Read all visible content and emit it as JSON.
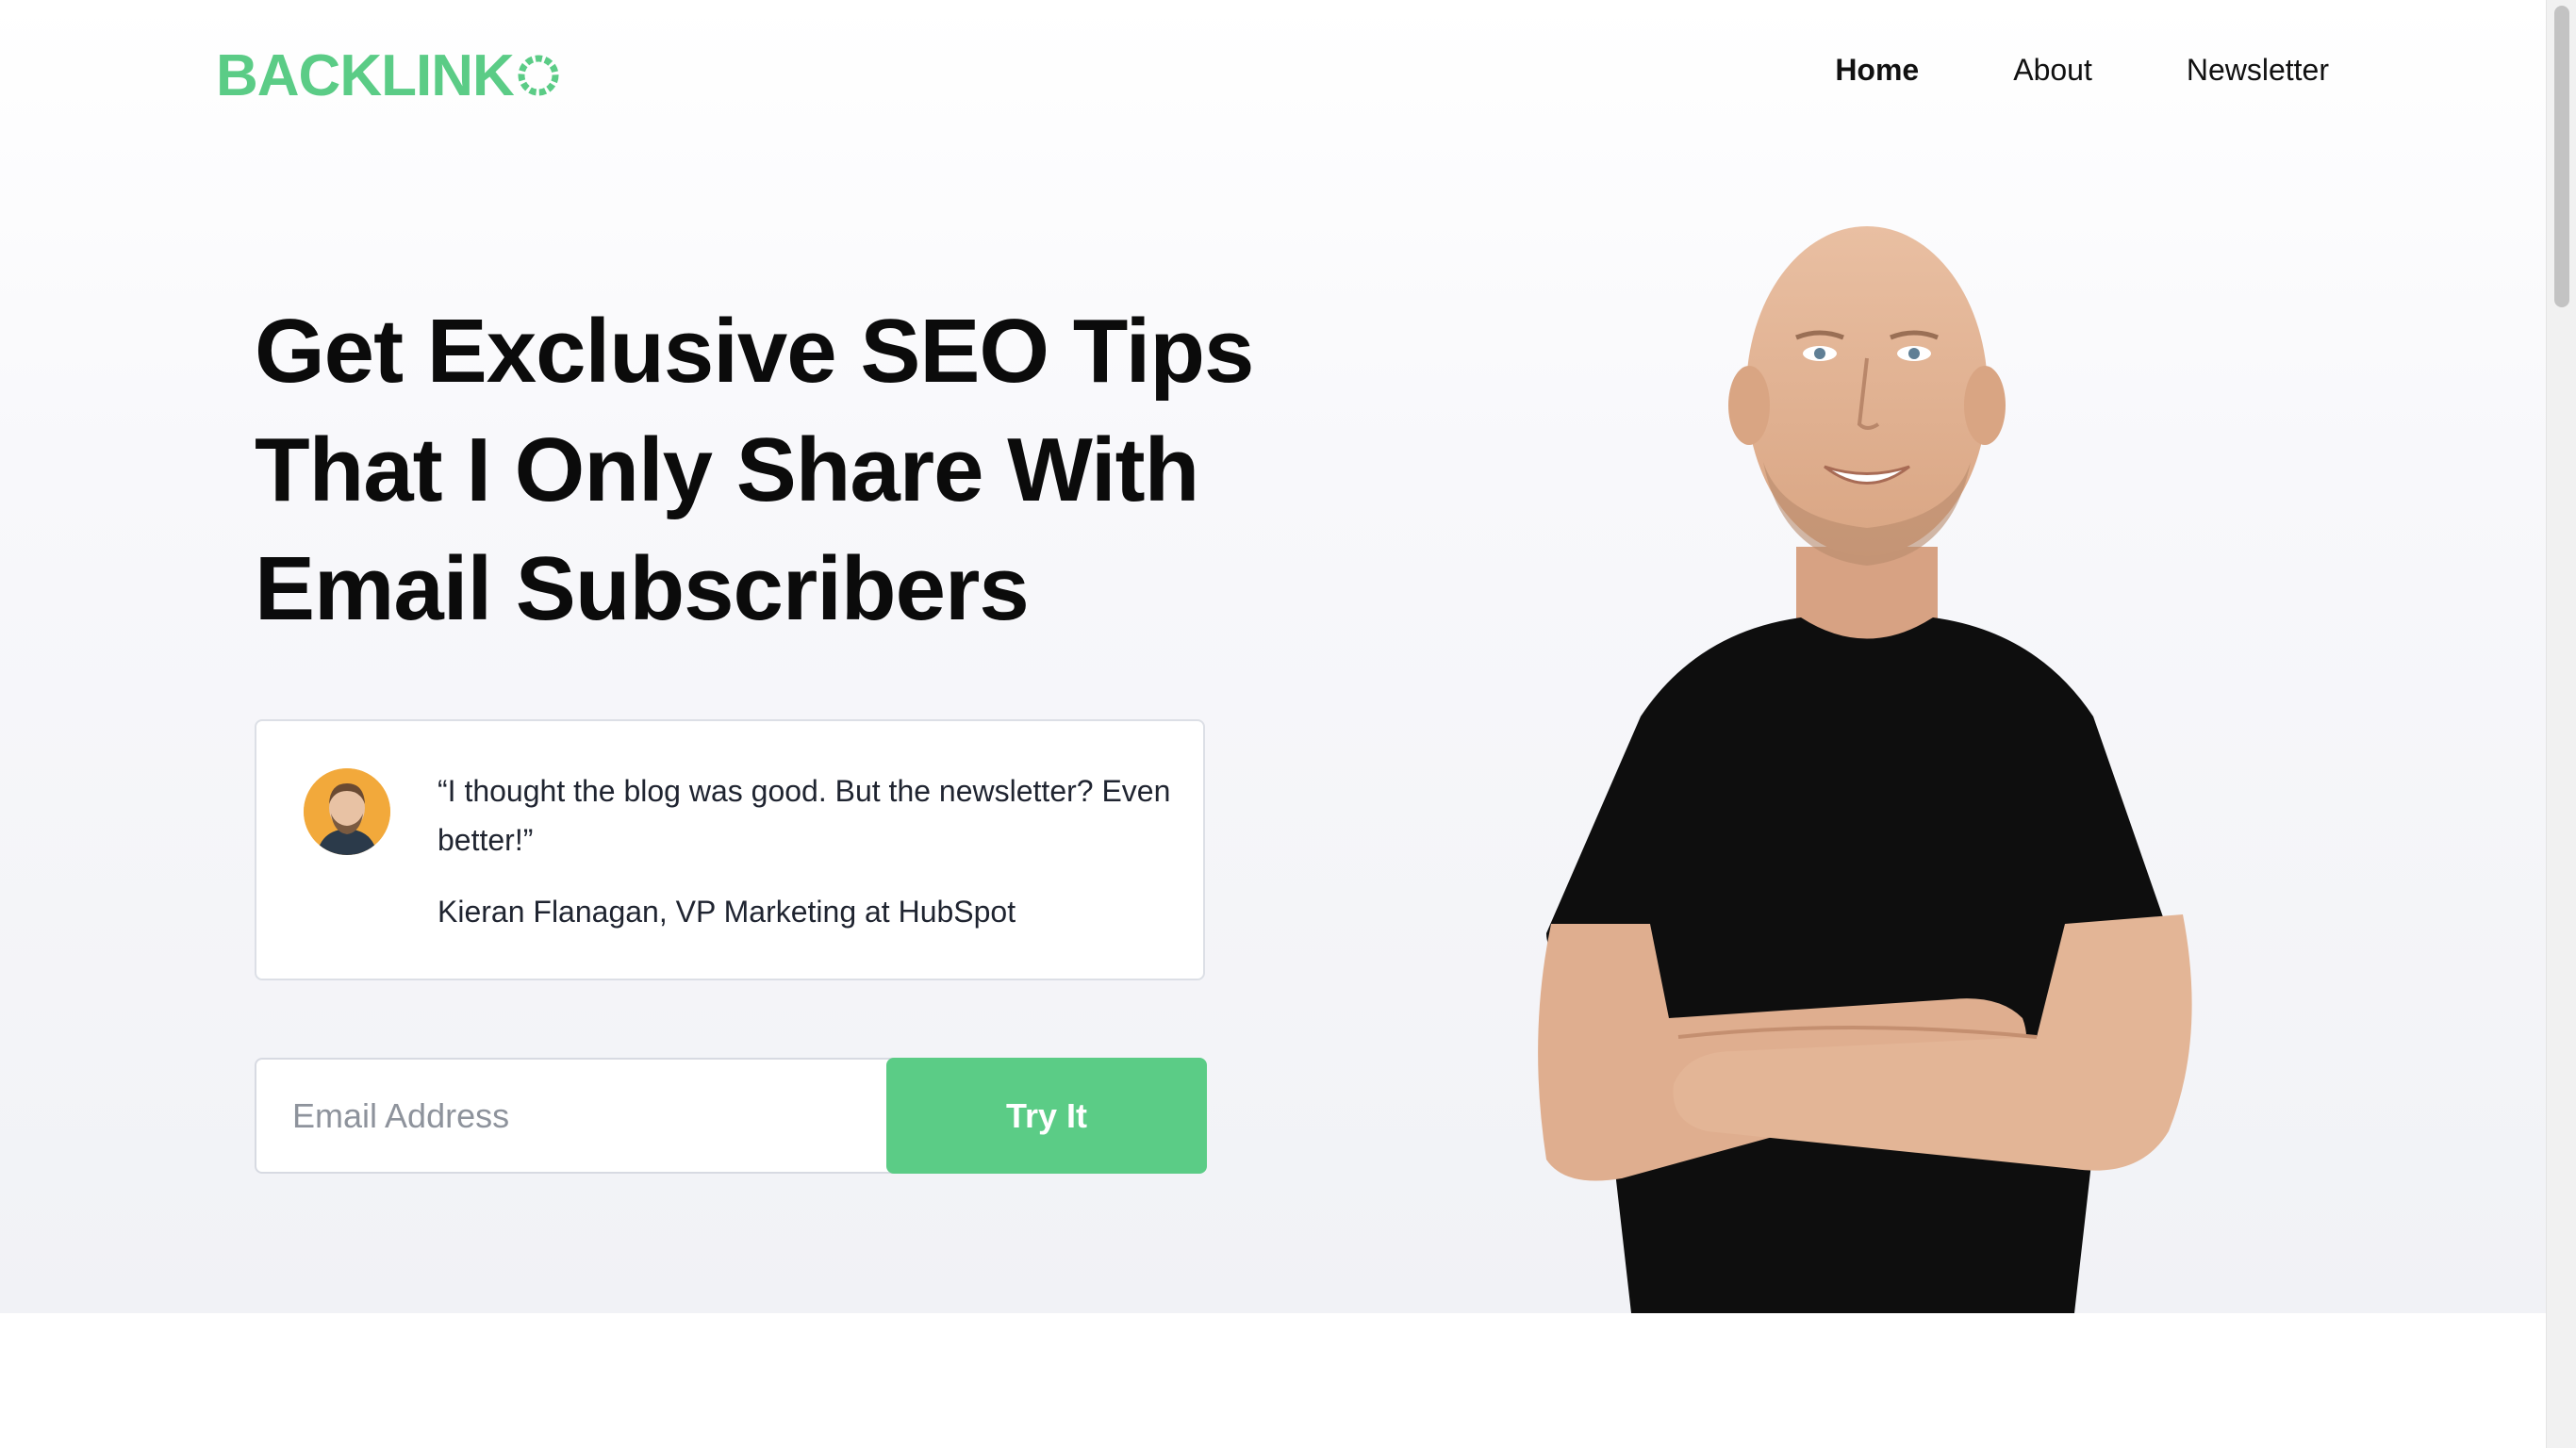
{
  "header": {
    "logo_text": "BACKLINK",
    "nav": [
      {
        "label": "Home",
        "active": true
      },
      {
        "label": "About",
        "active": false
      },
      {
        "label": "Newsletter",
        "active": false
      }
    ]
  },
  "hero": {
    "headline_lines": [
      "Get Exclusive SEO Tips",
      "That I Only Share With",
      "Email Subscribers"
    ],
    "testimonial": {
      "quote": "“I thought the blog was good. But the newsletter? Even better!”",
      "author": "Kieran Flanagan, VP Marketing at HubSpot"
    },
    "signup": {
      "email_placeholder": "Email Address",
      "button_label": "Try It"
    }
  },
  "colors": {
    "brand_green": "#5bcc86",
    "text_dark": "#0b0b0b",
    "border": "#dcdfe6"
  }
}
